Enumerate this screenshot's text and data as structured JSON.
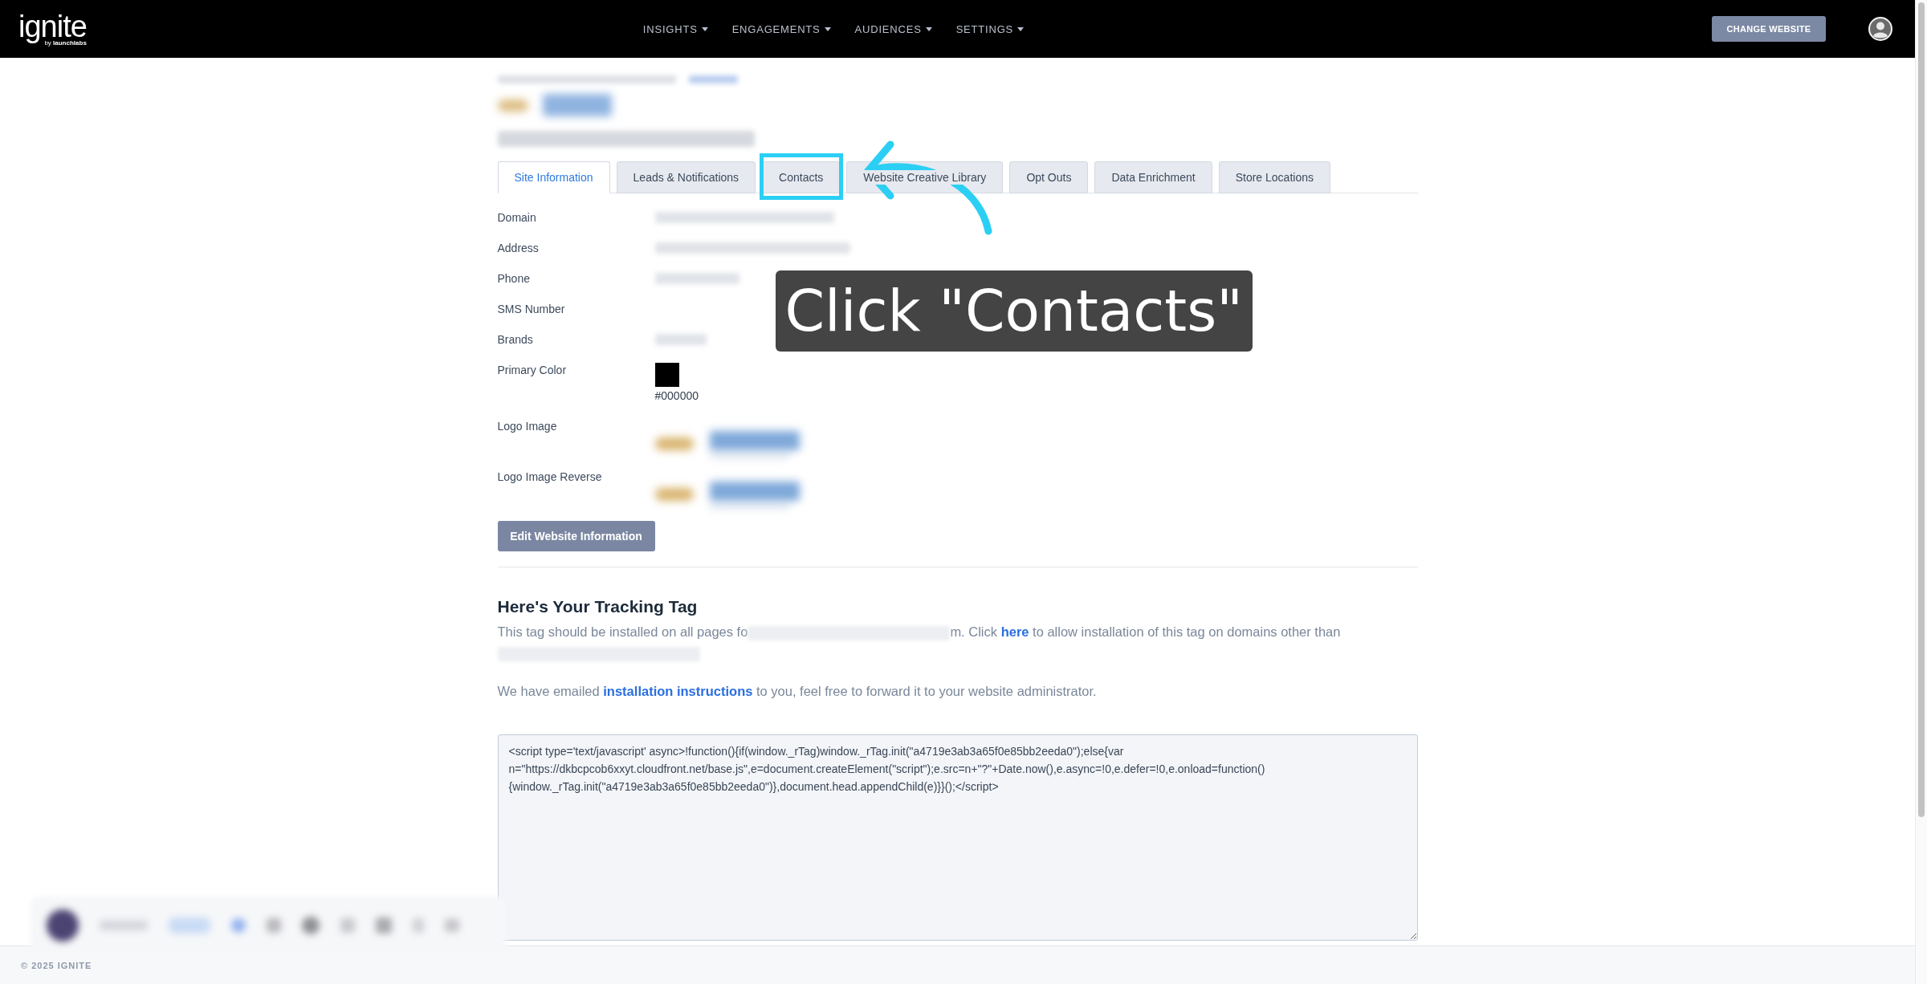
{
  "header": {
    "logo": "ignite",
    "tagline": "by **launchlabs**",
    "nav": [
      {
        "label": "INSIGHTS"
      },
      {
        "label": "ENGAGEMENTS"
      },
      {
        "label": "AUDIENCES"
      },
      {
        "label": "SETTINGS"
      }
    ],
    "action": "CHANGE WEBSITE"
  },
  "tabs": [
    {
      "label": "Site Information",
      "selected": true,
      "highlighted": false
    },
    {
      "label": "Leads & Notifications",
      "selected": false,
      "highlighted": false
    },
    {
      "label": "Contacts",
      "selected": false,
      "highlighted": true
    },
    {
      "label": "Website Creative Library",
      "selected": false,
      "highlighted": false
    },
    {
      "label": "Opt Outs",
      "selected": false,
      "highlighted": false
    },
    {
      "label": "Data Enrichment",
      "selected": false,
      "highlighted": false
    },
    {
      "label": "Store Locations",
      "selected": false,
      "highlighted": false
    }
  ],
  "fields": [
    {
      "label": "Domain",
      "kind": "redacted"
    },
    {
      "label": "Address",
      "kind": "redacted"
    },
    {
      "label": "Phone",
      "kind": "redacted"
    },
    {
      "label": "SMS Number",
      "kind": "empty"
    },
    {
      "label": "Brands",
      "kind": "redacted"
    },
    {
      "label": "Primary Color",
      "kind": "color",
      "value": "#000000"
    },
    {
      "label": "Logo Image",
      "kind": "image"
    },
    {
      "label": "Logo Image Reverse",
      "kind": "image"
    }
  ],
  "edit_button": "Edit Website Information",
  "tracking": {
    "title": "Here's Your Tracking Tag",
    "intro": [
      {
        "kind": "text",
        "text": "This tag should be installed on all pages fo"
      },
      {
        "kind": "redacted"
      },
      {
        "kind": "text",
        "text": "m. Click "
      },
      {
        "kind": "link",
        "text": "here"
      },
      {
        "kind": "text",
        "text": " to allow installation of this tag on domains other than "
      },
      {
        "kind": "redacted"
      }
    ],
    "emailed": [
      {
        "kind": "text",
        "text": "We have emailed "
      },
      {
        "kind": "link",
        "text": "installation instructions"
      },
      {
        "kind": "text",
        "text": " to you, feel free to forward it to your website administrator."
      }
    ],
    "code": "<script type='text/javascript' async>!function(){if(window._rTag)window._rTag.init(\"a4719e3ab3a65f0e85bb2eeda0\");else{var n=\"https://dkbcpcob6xxyt.cloudfront.net/base.js\",e=document.createElement(\"script\");e.src=n+\"?\"+Date.now(),e.async=!0,e.defer=!0,e.onload=function(){window._rTag.init(\"a4719e3ab3a65f0e85bb2eeda0\")},document.head.appendChild(e)}}();</script>"
  },
  "footer": "© 2025 IGNITE",
  "callout": {
    "text": "Click \"Contacts\""
  }
}
